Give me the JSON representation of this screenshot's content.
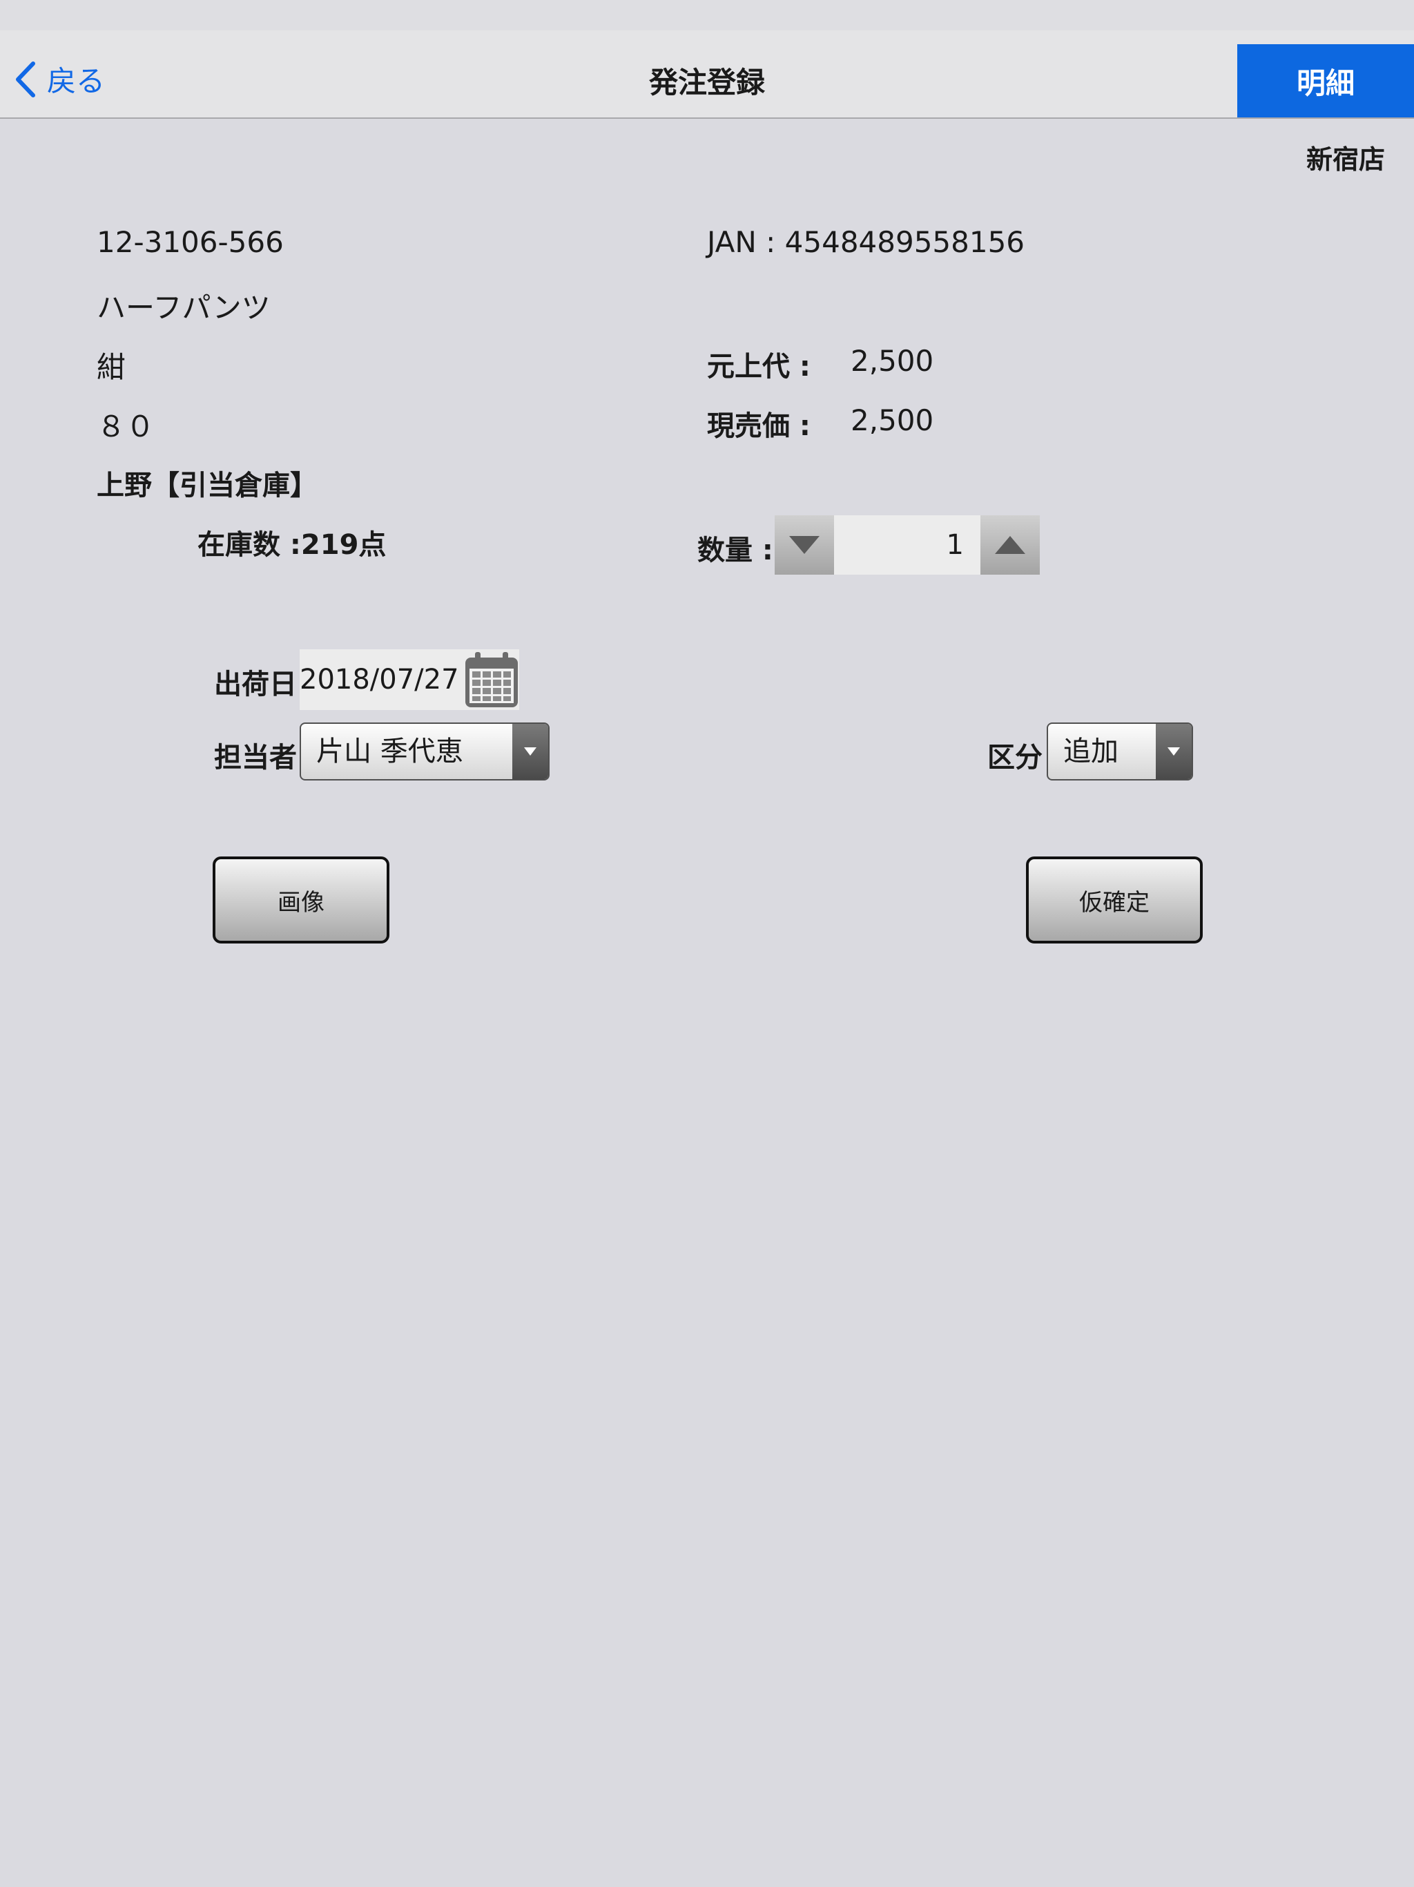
{
  "nav": {
    "back_label": "戻る",
    "title": "発注登録",
    "detail_label": "明細"
  },
  "store": "新宿店",
  "product": {
    "code": "12-3106-566",
    "name": "ハーフパンツ",
    "color": "紺",
    "size": "８０",
    "warehouse": "上野【引当倉庫】",
    "stock": "在庫数 :219点",
    "jan": "JAN : 4548489558156",
    "original_price_label": "元上代 :",
    "original_price": "2,500",
    "current_price_label": "現売価 :",
    "current_price": "2,500"
  },
  "quantity": {
    "label": "数量 :",
    "value": "1"
  },
  "ship_date": {
    "label": "出荷日",
    "value": "2018/07/27"
  },
  "staff": {
    "label": "担当者",
    "value": "片山 季代恵"
  },
  "category": {
    "label": "区分",
    "value": "追加"
  },
  "buttons": {
    "image": "画像",
    "provisional": "仮確定"
  },
  "colors": {
    "accent": "#0d68e0",
    "background": "#dadae0"
  }
}
